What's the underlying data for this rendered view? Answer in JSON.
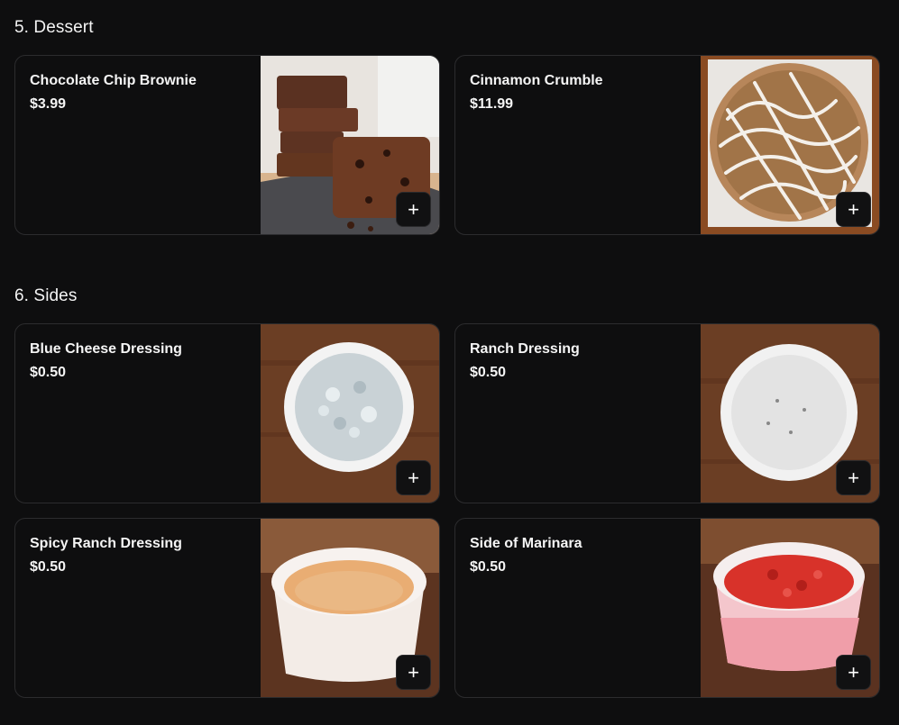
{
  "sections": [
    {
      "title": "5. Dessert",
      "items": [
        {
          "name": "Chocolate Chip Brownie",
          "price": "$3.99"
        },
        {
          "name": "Cinnamon Crumble",
          "price": "$11.99"
        }
      ]
    },
    {
      "title": "6. Sides",
      "items": [
        {
          "name": "Blue Cheese Dressing",
          "price": "$0.50"
        },
        {
          "name": "Ranch Dressing",
          "price": "$0.50"
        },
        {
          "name": "Spicy Ranch Dressing",
          "price": "$0.50"
        },
        {
          "name": "Side of Marinara",
          "price": "$0.50"
        }
      ]
    }
  ],
  "add_button_label": "+",
  "colors": {
    "background": "#0e0e0f",
    "card_border": "#2c2c2e",
    "text": "#f5f5f5"
  }
}
